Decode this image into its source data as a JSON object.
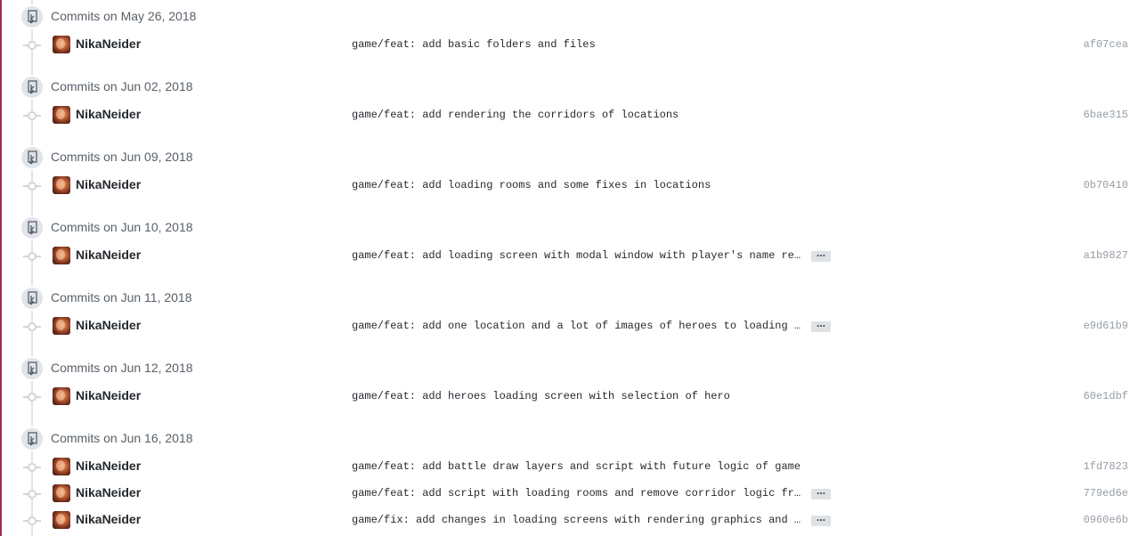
{
  "groups": [
    {
      "title": "Commits on May 26, 2018",
      "commits": [
        {
          "author": "NikaNeider",
          "message": "game/feat: add basic folders and files",
          "sha": "af07cea",
          "truncated": false
        }
      ]
    },
    {
      "title": "Commits on Jun 02, 2018",
      "commits": [
        {
          "author": "NikaNeider",
          "message": "game/feat: add rendering the corridors of locations",
          "sha": "6bae315",
          "truncated": false
        }
      ]
    },
    {
      "title": "Commits on Jun 09, 2018",
      "commits": [
        {
          "author": "NikaNeider",
          "message": "game/feat: add loading rooms and some fixes in locations",
          "sha": "0b70410",
          "truncated": false
        }
      ]
    },
    {
      "title": "Commits on Jun 10, 2018",
      "commits": [
        {
          "author": "NikaNeider",
          "message": "game/feat: add loading screen with modal window with player's name re…",
          "sha": "a1b9827",
          "truncated": true
        }
      ]
    },
    {
      "title": "Commits on Jun 11, 2018",
      "commits": [
        {
          "author": "NikaNeider",
          "message": "game/feat: add one location and a lot of images of heroes to loading …",
          "sha": "e9d61b9",
          "truncated": true
        }
      ]
    },
    {
      "title": "Commits on Jun 12, 2018",
      "commits": [
        {
          "author": "NikaNeider",
          "message": "game/feat: add heroes loading screen with selection of hero",
          "sha": "60e1dbf",
          "truncated": false
        }
      ]
    },
    {
      "title": "Commits on Jun 16, 2018",
      "commits": [
        {
          "author": "NikaNeider",
          "message": "game/feat: add battle draw layers and script with future logic of game",
          "sha": "1fd7823",
          "truncated": false
        },
        {
          "author": "NikaNeider",
          "message": "game/feat: add script with loading rooms and remove corridor logic fr…",
          "sha": "779ed6e",
          "truncated": true
        },
        {
          "author": "NikaNeider",
          "message": "game/fix: add changes in loading screens with rendering graphics and …",
          "sha": "0960e6b",
          "truncated": true
        }
      ]
    }
  ],
  "ellipsis_label": "…",
  "icons": {
    "group": "git-commit-group-icon",
    "dot": "commit-node-icon",
    "avatar": "user-avatar"
  },
  "colors": {
    "timeline": "#e1e4e8",
    "sha": "#959da5",
    "header_text": "#586069"
  }
}
